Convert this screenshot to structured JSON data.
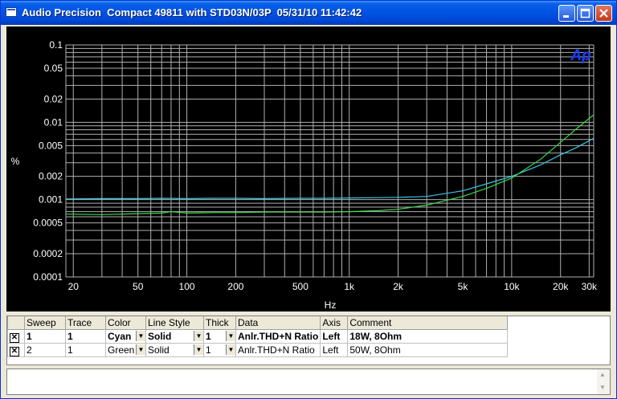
{
  "window": {
    "title": "Audio Precision  Compact 49811 with STD03N/03P  05/31/10 11:42:42"
  },
  "colors": {
    "title_bar": "#0055e5",
    "plot_bg": "#000000",
    "grid": "#b0b0b0",
    "cyan_trace": "#38c8e8",
    "green_trace": "#3cd84a",
    "logo": "#1a3cff"
  },
  "logo": {
    "text": "Ap"
  },
  "chart_data": {
    "type": "line",
    "xlabel": "Hz",
    "ylabel": "%",
    "x_scale": "log",
    "y_scale": "log",
    "xlim": [
      18,
      32000
    ],
    "ylim": [
      0.0001,
      0.1
    ],
    "grid": true,
    "x_ticks": [
      20,
      50,
      100,
      200,
      500,
      1000,
      2000,
      5000,
      10000,
      20000,
      30000
    ],
    "x_tick_labels": [
      "20",
      "50",
      "100",
      "200",
      "500",
      "1k",
      "2k",
      "5k",
      "10k",
      "20k",
      "30k"
    ],
    "y_ticks": [
      0.1,
      0.05,
      0.02,
      0.01,
      0.005,
      0.002,
      0.001,
      0.0005,
      0.0002,
      0.0001
    ],
    "y_tick_labels": [
      "0.1",
      "0.05",
      "0.02",
      "0.01",
      "0.005",
      "0.002",
      "0.001",
      "0.0005",
      "0.0002",
      "0.0001"
    ],
    "series": [
      {
        "color": "#38c8e8",
        "x": [
          18,
          30,
          50,
          70,
          100,
          150,
          200,
          300,
          500,
          700,
          1000,
          1500,
          2000,
          3000,
          5000,
          7000,
          10000,
          15000,
          20000,
          25000,
          32000
        ],
        "y": [
          0.00102,
          0.00103,
          0.00103,
          0.00104,
          0.00103,
          0.00104,
          0.00104,
          0.00103,
          0.00104,
          0.00104,
          0.00105,
          0.00106,
          0.00107,
          0.0011,
          0.0013,
          0.0016,
          0.002,
          0.0028,
          0.0038,
          0.0047,
          0.0062
        ]
      },
      {
        "color": "#3cd84a",
        "x": [
          18,
          30,
          50,
          70,
          80,
          100,
          150,
          200,
          300,
          500,
          700,
          1000,
          1500,
          2000,
          3000,
          5000,
          7000,
          10000,
          15000,
          20000,
          25000,
          32000
        ],
        "y": [
          0.00065,
          0.00064,
          0.00066,
          0.00067,
          0.0007,
          0.00067,
          0.00068,
          0.00068,
          0.00069,
          0.00069,
          0.00069,
          0.0007,
          0.00072,
          0.00075,
          0.00085,
          0.0011,
          0.0014,
          0.0019,
          0.0033,
          0.0055,
          0.0082,
          0.0125
        ]
      }
    ]
  },
  "legend": {
    "headers": [
      "Sweep",
      "Trace",
      "Color",
      "Line Style",
      "Thick",
      "Data",
      "Axis",
      "Comment"
    ],
    "rows": [
      {
        "checked": "✕",
        "sweep": "1",
        "trace": "1",
        "color": "Cyan",
        "style": "Solid",
        "thick": "1",
        "data": "Anlr.THD+N Ratio",
        "axis": "Left",
        "comment": "18W, 8Ohm"
      },
      {
        "checked": "✕",
        "sweep": "2",
        "trace": "1",
        "color": "Green",
        "style": "Solid",
        "thick": "1",
        "data": "Anlr.THD+N Ratio",
        "axis": "Left",
        "comment": "50W, 8Ohm"
      }
    ]
  }
}
